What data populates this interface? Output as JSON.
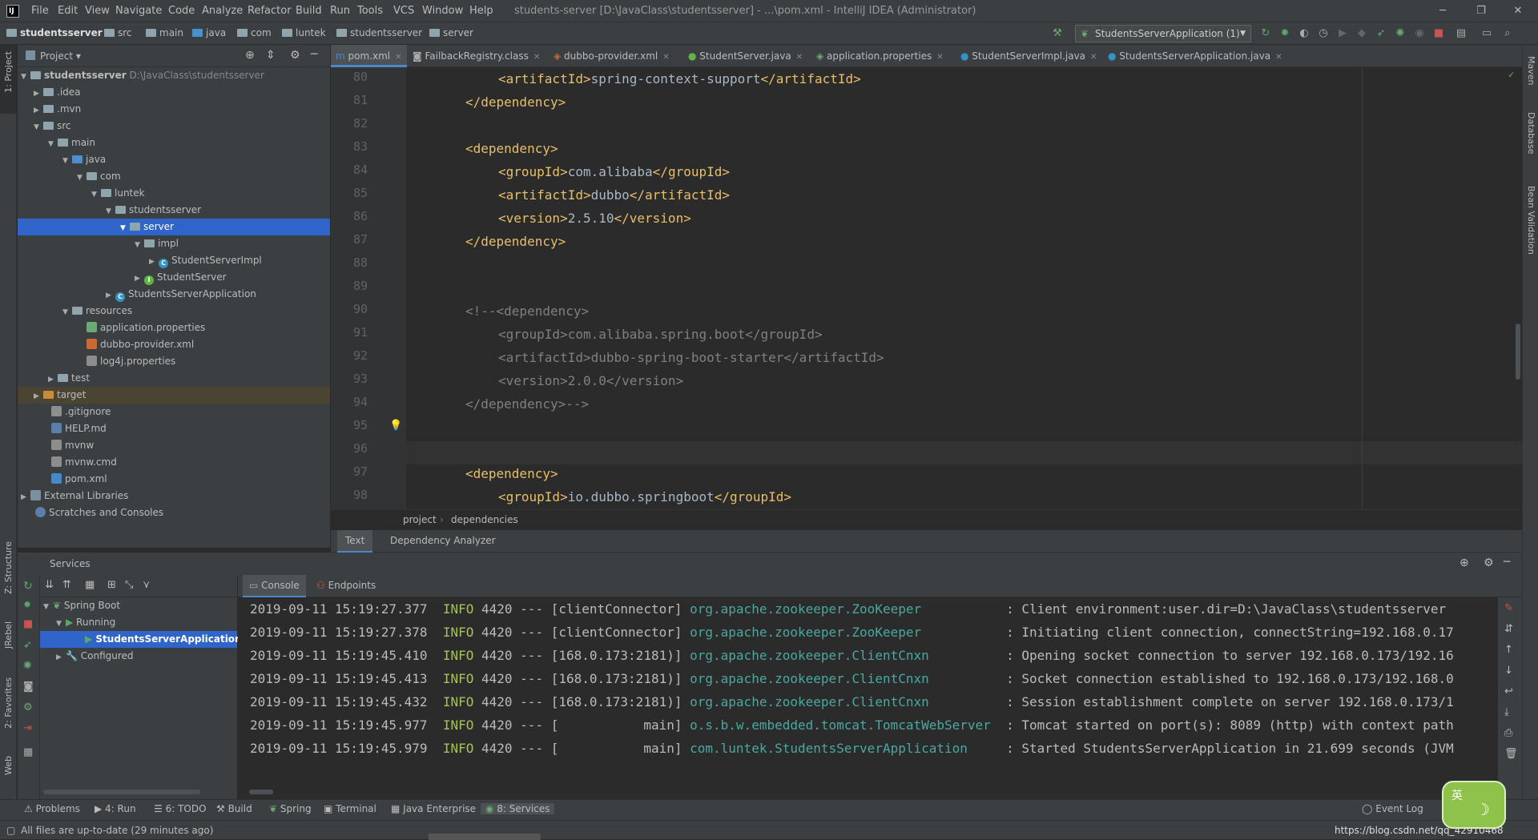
{
  "window": {
    "title": "students-server [D:\\JavaClass\\studentsserver] - ...\\pom.xml - IntelliJ IDEA (Administrator)",
    "menu": [
      "File",
      "Edit",
      "View",
      "Navigate",
      "Code",
      "Analyze",
      "Refactor",
      "Build",
      "Run",
      "Tools",
      "VCS",
      "Window",
      "Help"
    ]
  },
  "breadcrumb": [
    "studentsserver",
    "src",
    "main",
    "java",
    "com",
    "luntek",
    "studentsserver",
    "server"
  ],
  "run_config": "StudentsServerApplication (1)",
  "left_strip": {
    "project": "1: Project",
    "structure": "Z: Structure",
    "jrebel": "JRebel",
    "favorites": "2: Favorites",
    "web": "Web"
  },
  "right_strip": {
    "maven": "Maven",
    "database": "Database",
    "bean": "Bean Validation"
  },
  "project_panel": {
    "title": "Project",
    "tree": [
      {
        "label": "studentsserver",
        "path": "D:\\JavaClass\\studentsserver"
      },
      {
        "label": ".idea"
      },
      {
        "label": ".mvn"
      },
      {
        "label": "src"
      },
      {
        "label": "main"
      },
      {
        "label": "java"
      },
      {
        "label": "com"
      },
      {
        "label": "luntek"
      },
      {
        "label": "studentsserver"
      },
      {
        "label": "server"
      },
      {
        "label": "impl"
      },
      {
        "label": "StudentServerImpl"
      },
      {
        "label": "StudentServer"
      },
      {
        "label": "StudentsServerApplication"
      },
      {
        "label": "resources"
      },
      {
        "label": "application.properties"
      },
      {
        "label": "dubbo-provider.xml"
      },
      {
        "label": "log4j.properties"
      },
      {
        "label": "test"
      },
      {
        "label": "target"
      },
      {
        "label": ".gitignore"
      },
      {
        "label": "HELP.md"
      },
      {
        "label": "mvnw"
      },
      {
        "label": "mvnw.cmd"
      },
      {
        "label": "pom.xml"
      },
      {
        "label": "External Libraries"
      },
      {
        "label": "Scratches and Consoles"
      }
    ]
  },
  "editor_tabs": [
    "pom.xml",
    "FailbackRegistry.class",
    "dubbo-provider.xml",
    "StudentServer.java",
    "application.properties",
    "StudentServerImpl.java",
    "StudentsServerApplication.java"
  ],
  "code_lines": [
    {
      "n": "80"
    },
    {
      "n": "81"
    },
    {
      "n": "82"
    },
    {
      "n": "83"
    },
    {
      "n": "84"
    },
    {
      "n": "85"
    },
    {
      "n": "86"
    },
    {
      "n": "87"
    },
    {
      "n": "88"
    },
    {
      "n": "89"
    },
    {
      "n": "90"
    },
    {
      "n": "91"
    },
    {
      "n": "92"
    },
    {
      "n": "93"
    },
    {
      "n": "94"
    },
    {
      "n": "95"
    },
    {
      "n": "96"
    },
    {
      "n": "97"
    },
    {
      "n": "98"
    }
  ],
  "code": {
    "l80a": "<artifactId>",
    "l80b": "spring-context-support",
    "l80c": "</artifactId>",
    "l81": "</dependency>",
    "l83": "<dependency>",
    "l84a": "<groupId>",
    "l84b": "com.alibaba",
    "l84c": "</groupId>",
    "l85a": "<artifactId>",
    "l85b": "dubbo",
    "l85c": "</artifactId>",
    "l86a": "<version>",
    "l86b": "2.5.10",
    "l86c": "</version>",
    "l87": "</dependency>",
    "l90": "<!--<dependency>",
    "l91": "<groupId>com.alibaba.spring.boot</groupId>",
    "l92": "<artifactId>dubbo-spring-boot-starter</artifactId>",
    "l93": "<version>2.0.0</version>",
    "l94": "</dependency>-->",
    "l97": "<dependency>",
    "l98a": "<groupId>",
    "l98b": "io.dubbo.springboot",
    "l98c": "</groupId>"
  },
  "editor_breadcrumb": [
    "project",
    "dependencies"
  ],
  "editor_bottom_tabs": [
    "Text",
    "Dependency Analyzer"
  ],
  "services": {
    "title": "Services",
    "tree": [
      "Spring Boot",
      "Running",
      "StudentsServerApplication",
      "Configured"
    ],
    "tabs": [
      "Console",
      "Endpoints"
    ]
  },
  "log": [
    {
      "ts": "2019-09-11 15:19:27.377",
      "lvl": "INFO",
      "pid": "4420",
      "sep": "---",
      "thread": "[clientConnector]",
      "cls": "org.apache.zookeeper.ZooKeeper",
      "msg": ": Client environment:user.dir=D:\\JavaClass\\studentsserver"
    },
    {
      "ts": "2019-09-11 15:19:27.378",
      "lvl": "INFO",
      "pid": "4420",
      "sep": "---",
      "thread": "[clientConnector]",
      "cls": "org.apache.zookeeper.ZooKeeper",
      "msg": ": Initiating client connection, connectString=192.168.0.17"
    },
    {
      "ts": "2019-09-11 15:19:45.410",
      "lvl": "INFO",
      "pid": "4420",
      "sep": "---",
      "thread": "[168.0.173:2181)]",
      "cls": "org.apache.zookeeper.ClientCnxn",
      "msg": ": Opening socket connection to server 192.168.0.173/192.16"
    },
    {
      "ts": "2019-09-11 15:19:45.413",
      "lvl": "INFO",
      "pid": "4420",
      "sep": "---",
      "thread": "[168.0.173:2181)]",
      "cls": "org.apache.zookeeper.ClientCnxn",
      "msg": ": Socket connection established to 192.168.0.173/192.168.0"
    },
    {
      "ts": "2019-09-11 15:19:45.432",
      "lvl": "INFO",
      "pid": "4420",
      "sep": "---",
      "thread": "[168.0.173:2181)]",
      "cls": "org.apache.zookeeper.ClientCnxn",
      "msg": ": Session establishment complete on server 192.168.0.173/1"
    },
    {
      "ts": "2019-09-11 15:19:45.977",
      "lvl": "INFO",
      "pid": "4420",
      "sep": "---",
      "thread": "[           main]",
      "cls": "o.s.b.w.embedded.tomcat.TomcatWebServer",
      "msg": ": Tomcat started on port(s): 8089 (http) with context path"
    },
    {
      "ts": "2019-09-11 15:19:45.979",
      "lvl": "INFO",
      "pid": "4420",
      "sep": "---",
      "thread": "[           main]",
      "cls": "com.luntek.StudentsServerApplication",
      "msg": ": Started StudentsServerApplication in 21.699 seconds (JVM"
    }
  ],
  "bottom_tabs": [
    "Problems",
    "4: Run",
    "6: TODO",
    "Build",
    "Spring",
    "Terminal",
    "Java Enterprise",
    "8: Services"
  ],
  "event_log": "Event Log",
  "status": "All files are up-to-date (29 minutes ago)",
  "watermark": "https://blog.csdn.net/qq_42910468",
  "ime": "英"
}
